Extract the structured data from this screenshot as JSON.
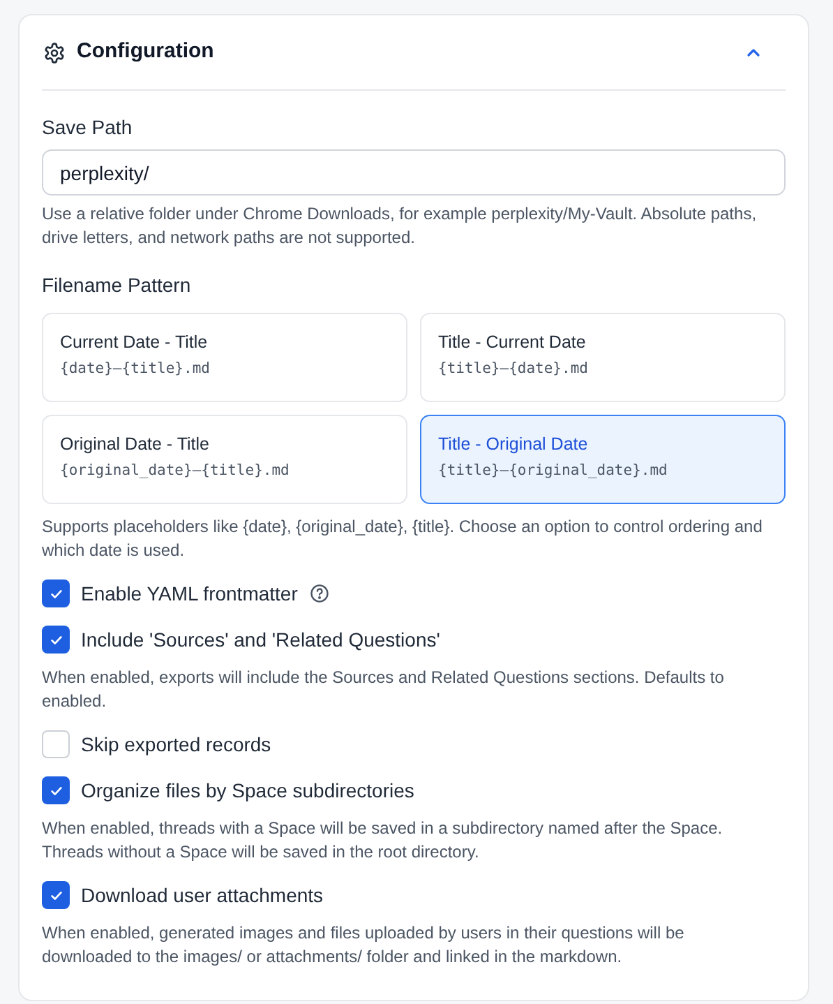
{
  "section": {
    "title": "Configuration",
    "expanded": true
  },
  "save_path": {
    "label": "Save Path",
    "value": "perplexity/",
    "help": "Use a relative folder under Chrome Downloads, for example perplexity/My-Vault. Absolute paths, drive letters, and network paths are not supported."
  },
  "filename_pattern": {
    "label": "Filename Pattern",
    "options": [
      {
        "title": "Current Date - Title",
        "pattern": "{date}—{title}.md",
        "selected": false
      },
      {
        "title": "Title - Current Date",
        "pattern": "{title}—{date}.md",
        "selected": false
      },
      {
        "title": "Original Date - Title",
        "pattern": "{original_date}—{title}.md",
        "selected": false
      },
      {
        "title": "Title - Original Date",
        "pattern": "{title}—{original_date}.md",
        "selected": true
      }
    ],
    "help": "Supports placeholders like {date}, {original_date}, {title}. Choose an option to control ordering and which date is used."
  },
  "options": [
    {
      "label": "Enable YAML frontmatter",
      "checked": true,
      "has_help_icon": true
    },
    {
      "label": "Include 'Sources' and 'Related Questions'",
      "checked": true,
      "help": "When enabled, exports will include the Sources and Related Questions sections. Defaults to enabled."
    },
    {
      "label": "Skip exported records",
      "checked": false
    },
    {
      "label": "Organize files by Space subdirectories",
      "checked": true,
      "help": "When enabled, threads with a Space will be saved in a subdirectory named after the Space. Threads without a Space will be saved in the root directory."
    },
    {
      "label": "Download user attachments",
      "checked": true,
      "help": "When enabled, generated images and files uploaded by users in their questions will be downloaded to the images/ or attachments/ folder and linked in the markdown."
    }
  ]
}
